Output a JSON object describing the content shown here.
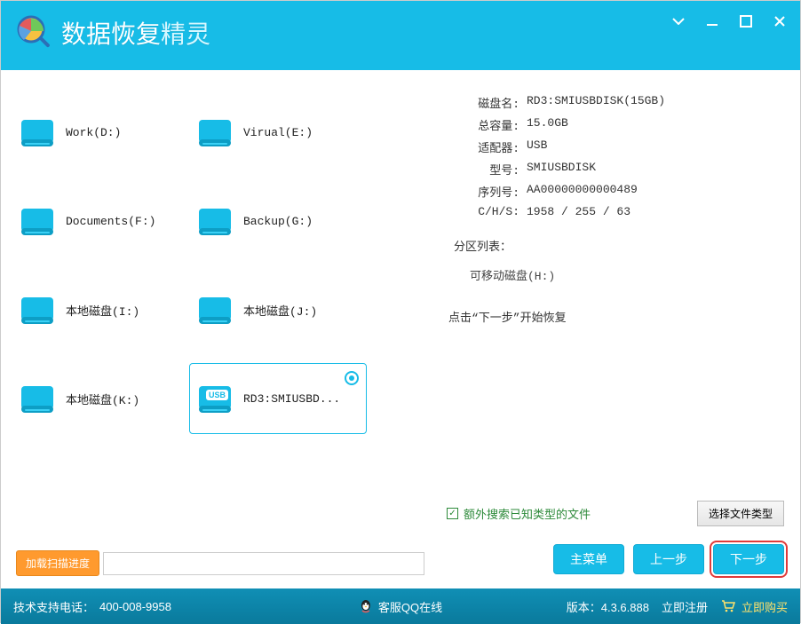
{
  "titlebar": {
    "app_name_main": "数据恢复",
    "app_name_accent": "精灵"
  },
  "drives": [
    {
      "label": "Work(D:)",
      "type": "hdd"
    },
    {
      "label": "Virual(E:)",
      "type": "hdd"
    },
    {
      "label": "Documents(F:)",
      "type": "hdd"
    },
    {
      "label": "Backup(G:)",
      "type": "hdd"
    },
    {
      "label": "本地磁盘(I:)",
      "type": "hdd"
    },
    {
      "label": "本地磁盘(J:)",
      "type": "hdd"
    },
    {
      "label": "本地磁盘(K:)",
      "type": "hdd"
    },
    {
      "label": "RD3:SMIUSBD...",
      "type": "usb",
      "selected": true
    }
  ],
  "load_progress_button": "加载扫描进度",
  "disk_info": {
    "name_key": "磁盘名:",
    "name_val": "RD3:SMIUSBDISK(15GB)",
    "total_key": "总容量:",
    "total_val": "15.0GB",
    "adapter_key": "适配器:",
    "adapter_val": "USB",
    "model_key": "型号:",
    "model_val": "SMIUSBDISK",
    "serial_key": "序列号:",
    "serial_val": "AA00000000000489",
    "chs_key": "C/H/S:",
    "chs_val": "1958 / 255 / 63"
  },
  "partition_title": "分区列表：",
  "partition_item": "可移动磁盘(H:)",
  "start_hint": "点击“下一步”开始恢复",
  "checkbox_label": "额外搜索已知类型的文件",
  "select_filetype_button": "选择文件类型",
  "nav": {
    "main_menu": "主菜单",
    "prev": "上一步",
    "next": "下一步"
  },
  "statusbar": {
    "support_label": "技术支持电话：",
    "support_phone": "400-008-9958",
    "qq_label": "客服QQ在线",
    "version_label": "版本：",
    "version": "4.3.6.888",
    "register": "立即注册",
    "buy": "立即购买"
  }
}
